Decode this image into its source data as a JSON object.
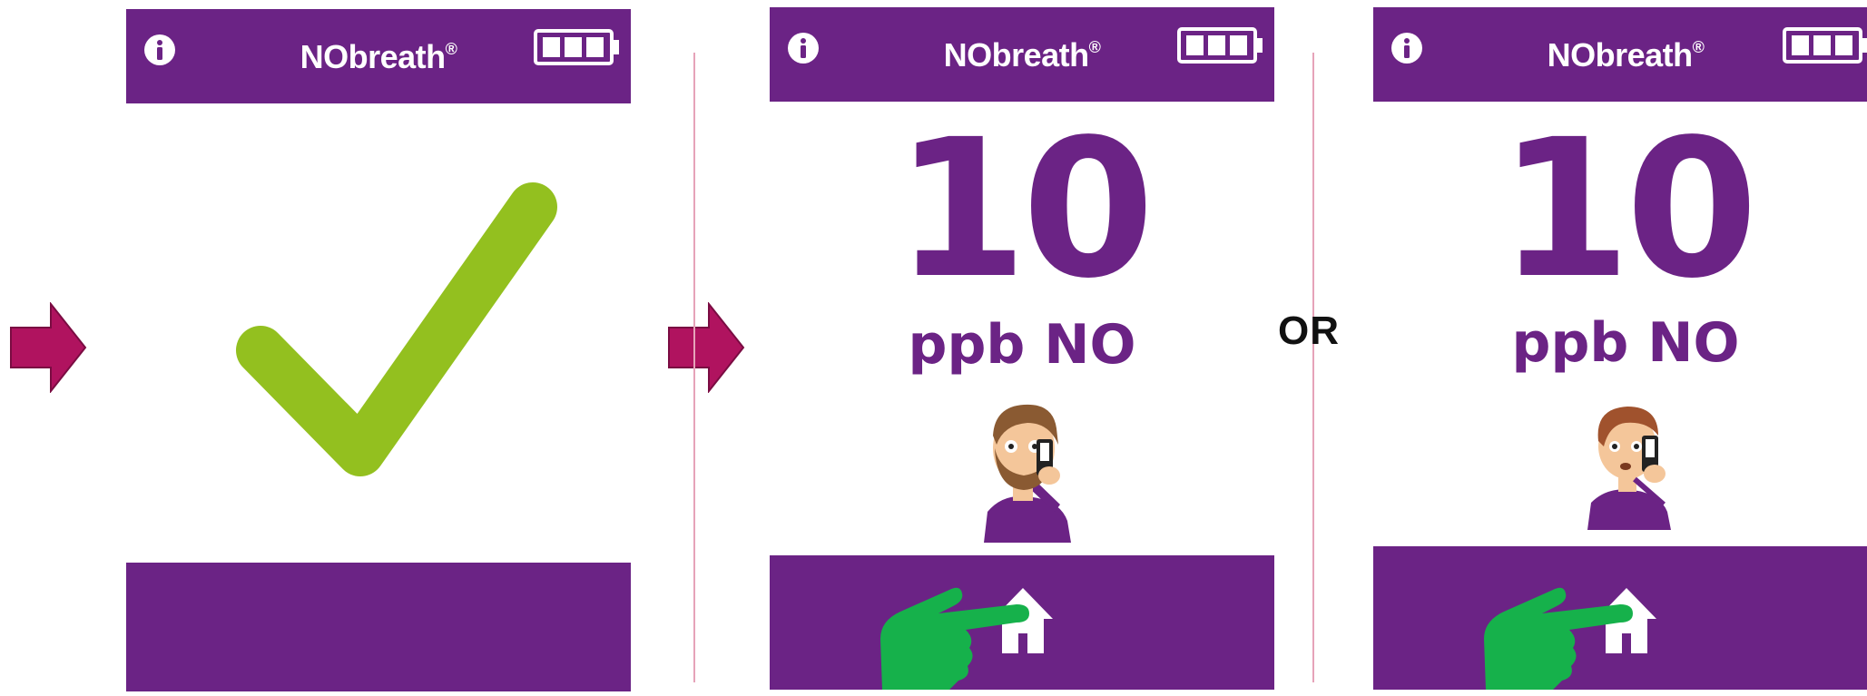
{
  "colors": {
    "brand_purple": "#6b2385",
    "check_green": "#93c01f",
    "arrow_magenta": "#b0135f",
    "pointer_green": "#16b14b",
    "divider_pink": "#e6a3b9"
  },
  "screens": [
    {
      "brand_name": "NObreath",
      "brand_mark": "®",
      "icons": [
        "info-icon",
        "battery-full-icon",
        "checkmark-icon"
      ]
    },
    {
      "brand_name": "NObreath",
      "brand_mark": "®",
      "reading": "10",
      "unit": "ppb NO",
      "icons": [
        "info-icon",
        "battery-full-icon",
        "adult-patient-icon",
        "pointing-hand-icon",
        "home-icon"
      ]
    },
    {
      "brand_name": "NObreath",
      "brand_mark": "®",
      "reading": "10",
      "unit": "ppb NO",
      "icons": [
        "info-icon",
        "battery-full-icon",
        "child-patient-icon",
        "pointing-hand-icon",
        "home-icon"
      ]
    }
  ],
  "or_label": "OR",
  "flow_icons": [
    "arrow-right-icon",
    "arrow-right-icon"
  ]
}
